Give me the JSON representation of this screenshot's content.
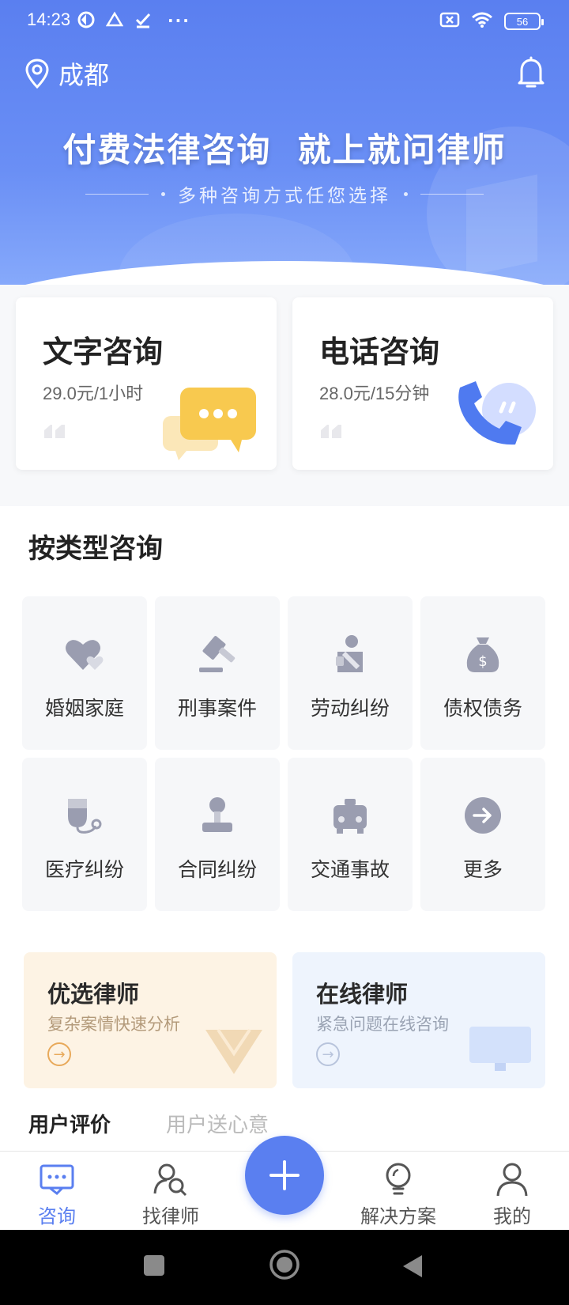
{
  "status_bar": {
    "time": "14:23",
    "more_dots": "···",
    "battery": "56"
  },
  "header": {
    "city": "成都",
    "title": "付费法律咨询  就上就问律师",
    "subtitle": "多种咨询方式任您选择"
  },
  "consult_cards": [
    {
      "title": "文字咨询",
      "price": "29.0元/1小时",
      "icon": "chat-bubble-icon"
    },
    {
      "title": "电话咨询",
      "price": "28.0元/15分钟",
      "icon": "phone-icon"
    }
  ],
  "category_section": {
    "title": "按类型咨询",
    "items": [
      {
        "label": "婚姻家庭",
        "icon": "hearts-icon"
      },
      {
        "label": "刑事案件",
        "icon": "gavel-icon"
      },
      {
        "label": "劳动纠纷",
        "icon": "worker-icon"
      },
      {
        "label": "债权债务",
        "icon": "money-bag-icon"
      },
      {
        "label": "医疗纠纷",
        "icon": "medical-icon"
      },
      {
        "label": "合同纠纷",
        "icon": "stamp-icon"
      },
      {
        "label": "交通事故",
        "icon": "car-icon"
      },
      {
        "label": "更多",
        "icon": "arrow-right-icon"
      }
    ]
  },
  "promos": [
    {
      "title": "优选律师",
      "subtitle": "复杂案情快速分析",
      "bg": "#fdf3e4",
      "accent": "#e8a95a"
    },
    {
      "title": "在线律师",
      "subtitle": "紧急问题在线咨询",
      "bg": "#eef4fd",
      "accent": "#9fb3d9"
    }
  ],
  "reviews": {
    "tab1": "用户评价",
    "tab2": "用户送心意"
  },
  "tabbar": {
    "items": [
      {
        "label": "咨询",
        "icon": "chat-icon",
        "active": true
      },
      {
        "label": "找律师",
        "icon": "find-lawyer-icon",
        "active": false
      },
      {
        "label": "解决方案",
        "icon": "lightbulb-icon",
        "active": false
      },
      {
        "label": "我的",
        "icon": "person-icon",
        "active": false
      }
    ],
    "fab_icon": "plus-icon"
  },
  "colors": {
    "primary": "#5a7ff0",
    "card_bg": "#f6f7f9",
    "icon_gray": "#9a9db0"
  }
}
